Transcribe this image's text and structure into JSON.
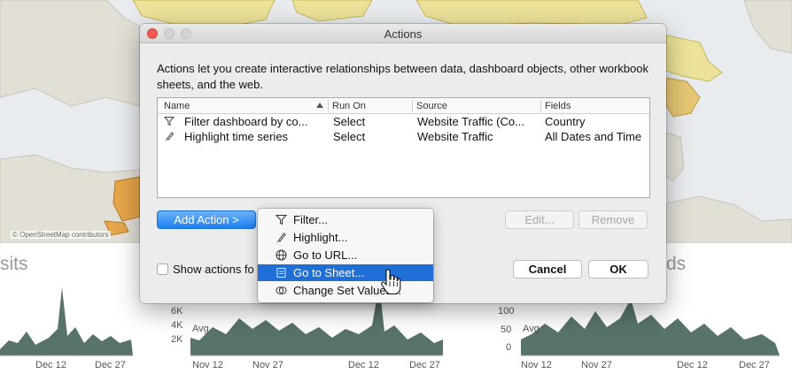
{
  "background": {
    "attribution": "© OpenStreetMap contributors",
    "left_title_fragment": "sits",
    "right_title_fragment": "ds",
    "chart_left": {
      "x_ticks": [
        "Dec 12",
        "Dec 27"
      ]
    },
    "chart_mid": {
      "y_ticks": [
        "6K",
        "4K",
        "2K"
      ],
      "avg_label": "Avg",
      "x_ticks": [
        "Nov 12",
        "Nov 27",
        "Dec 12",
        "Dec 27"
      ]
    },
    "chart_right": {
      "y_ticks": [
        "100",
        "50",
        "0"
      ],
      "avg_label": "Avg",
      "x_ticks": [
        "Nov 12",
        "Nov 27",
        "Dec 12",
        "Dec 27"
      ]
    }
  },
  "dialog": {
    "title": "Actions",
    "description": "Actions let you create interactive relationships between data, dashboard objects, other workbook sheets, and the web.",
    "columns": [
      "Name",
      "Run On",
      "Source",
      "Fields"
    ],
    "rows": [
      {
        "icon": "filter-icon",
        "name": "Filter dashboard by co...",
        "run_on": "Select",
        "source": "Website Traffic (Co...",
        "fields": "Country"
      },
      {
        "icon": "highlight-icon",
        "name": "Highlight time series",
        "run_on": "Select",
        "source": "Website Traffic",
        "fields": "All Dates and Time"
      }
    ],
    "add_action_label": "Add Action >",
    "edit_label": "Edit...",
    "remove_label": "Remove",
    "show_actions_label": "Show actions fo",
    "cancel_label": "Cancel",
    "ok_label": "OK"
  },
  "menu": {
    "items": [
      {
        "label": "Filter...",
        "icon": "filter-icon"
      },
      {
        "label": "Highlight...",
        "icon": "highlight-icon"
      },
      {
        "label": "Go to URL...",
        "icon": "globe-icon"
      },
      {
        "label": "Go to Sheet...",
        "icon": "sheet-icon",
        "selected": true
      },
      {
        "label": "Change Set Values...",
        "icon": "set-icon"
      }
    ]
  },
  "colors": {
    "accent": "#1f6fd6",
    "map_land": "#f0e08a",
    "map_land_alt": "#e7a64a",
    "area_fill": "#58726c"
  }
}
